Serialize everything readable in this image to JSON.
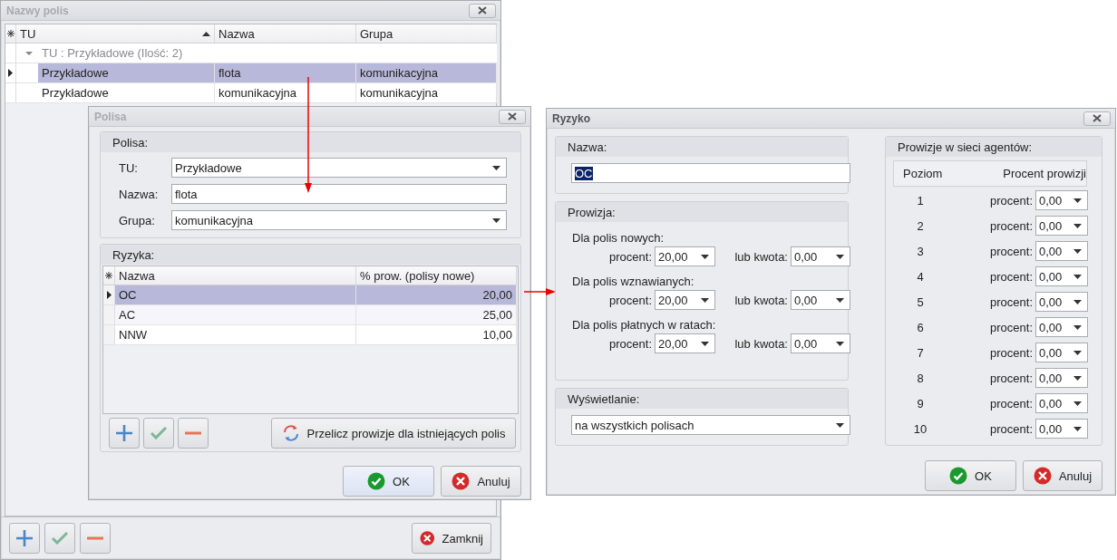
{
  "main_window": {
    "title": "Nazwy polis",
    "active": false,
    "columns": [
      {
        "label": "TU",
        "sorted": true
      },
      {
        "label": "Nazwa"
      },
      {
        "label": "Grupa"
      }
    ],
    "group": {
      "label": "TU : Przykładowe (Ilość: 2)",
      "expanded": true
    },
    "rows": [
      {
        "cells": [
          "Przykładowe",
          "flota",
          "komunikacyjna"
        ],
        "selected": true
      },
      {
        "cells": [
          "Przykładowe",
          "komunikacyjna",
          "komunikacyjna"
        ],
        "selected": false
      }
    ],
    "close_button": "Zamknij"
  },
  "policy_dialog": {
    "title": "Polisa",
    "active": false,
    "section": "Polisa:",
    "fields": [
      {
        "label": "TU:",
        "value": "Przykładowe",
        "kind": "dropdown"
      },
      {
        "label": "Nazwa:",
        "value": "flota",
        "kind": "text"
      },
      {
        "label": "Grupa:",
        "value": "komunikacyjna",
        "kind": "dropdown"
      }
    ],
    "risks_section": "Ryzyka:",
    "risk_columns": [
      "Nazwa",
      "% prow. (polisy nowe)"
    ],
    "risks": [
      {
        "name": "OC",
        "value": "20,00",
        "selected": true
      },
      {
        "name": "AC",
        "value": "25,00",
        "selected": false
      },
      {
        "name": "NNW",
        "value": "10,00",
        "selected": false
      }
    ],
    "recalc_button": "Przelicz prowizje dla istniejących polis",
    "ok": "OK",
    "cancel": "Anuluj"
  },
  "risk_dialog": {
    "title": "Ryzyko",
    "active": true,
    "name_section": "Nazwa:",
    "name_value": "OC",
    "name_text_selected": true,
    "commission_section": "Prowizja:",
    "commission_groups": [
      {
        "label": "Dla polis nowych:",
        "percent_label": "procent:",
        "percent": "20,00",
        "amount_label": "lub kwota:",
        "amount": "0,00"
      },
      {
        "label": "Dla polis wznawianych:",
        "percent_label": "procent:",
        "percent": "20,00",
        "amount_label": "lub kwota:",
        "amount": "0,00"
      },
      {
        "label": "Dla polis płatnych w ratach:",
        "percent_label": "procent:",
        "percent": "20,00",
        "amount_label": "lub kwota:",
        "amount": "0,00"
      }
    ],
    "display_section": "Wyświetlanie:",
    "display_value": "na wszystkich polisach",
    "agents_section": "Prowizje w sieci agentów:",
    "agents_columns": [
      "Poziom",
      "Procent prowizji"
    ],
    "agents": [
      {
        "level": "1",
        "label": "procent:",
        "value": "0,00"
      },
      {
        "level": "2",
        "label": "procent:",
        "value": "0,00"
      },
      {
        "level": "3",
        "label": "procent:",
        "value": "0,00"
      },
      {
        "level": "4",
        "label": "procent:",
        "value": "0,00"
      },
      {
        "level": "5",
        "label": "procent:",
        "value": "0,00"
      },
      {
        "level": "6",
        "label": "procent:",
        "value": "0,00"
      },
      {
        "level": "7",
        "label": "procent:",
        "value": "0,00"
      },
      {
        "level": "8",
        "label": "procent:",
        "value": "0,00"
      },
      {
        "level": "9",
        "label": "procent:",
        "value": "0,00"
      },
      {
        "level": "10",
        "label": "procent:",
        "value": "0,00"
      }
    ],
    "ok": "OK",
    "cancel": "Anuluj"
  }
}
